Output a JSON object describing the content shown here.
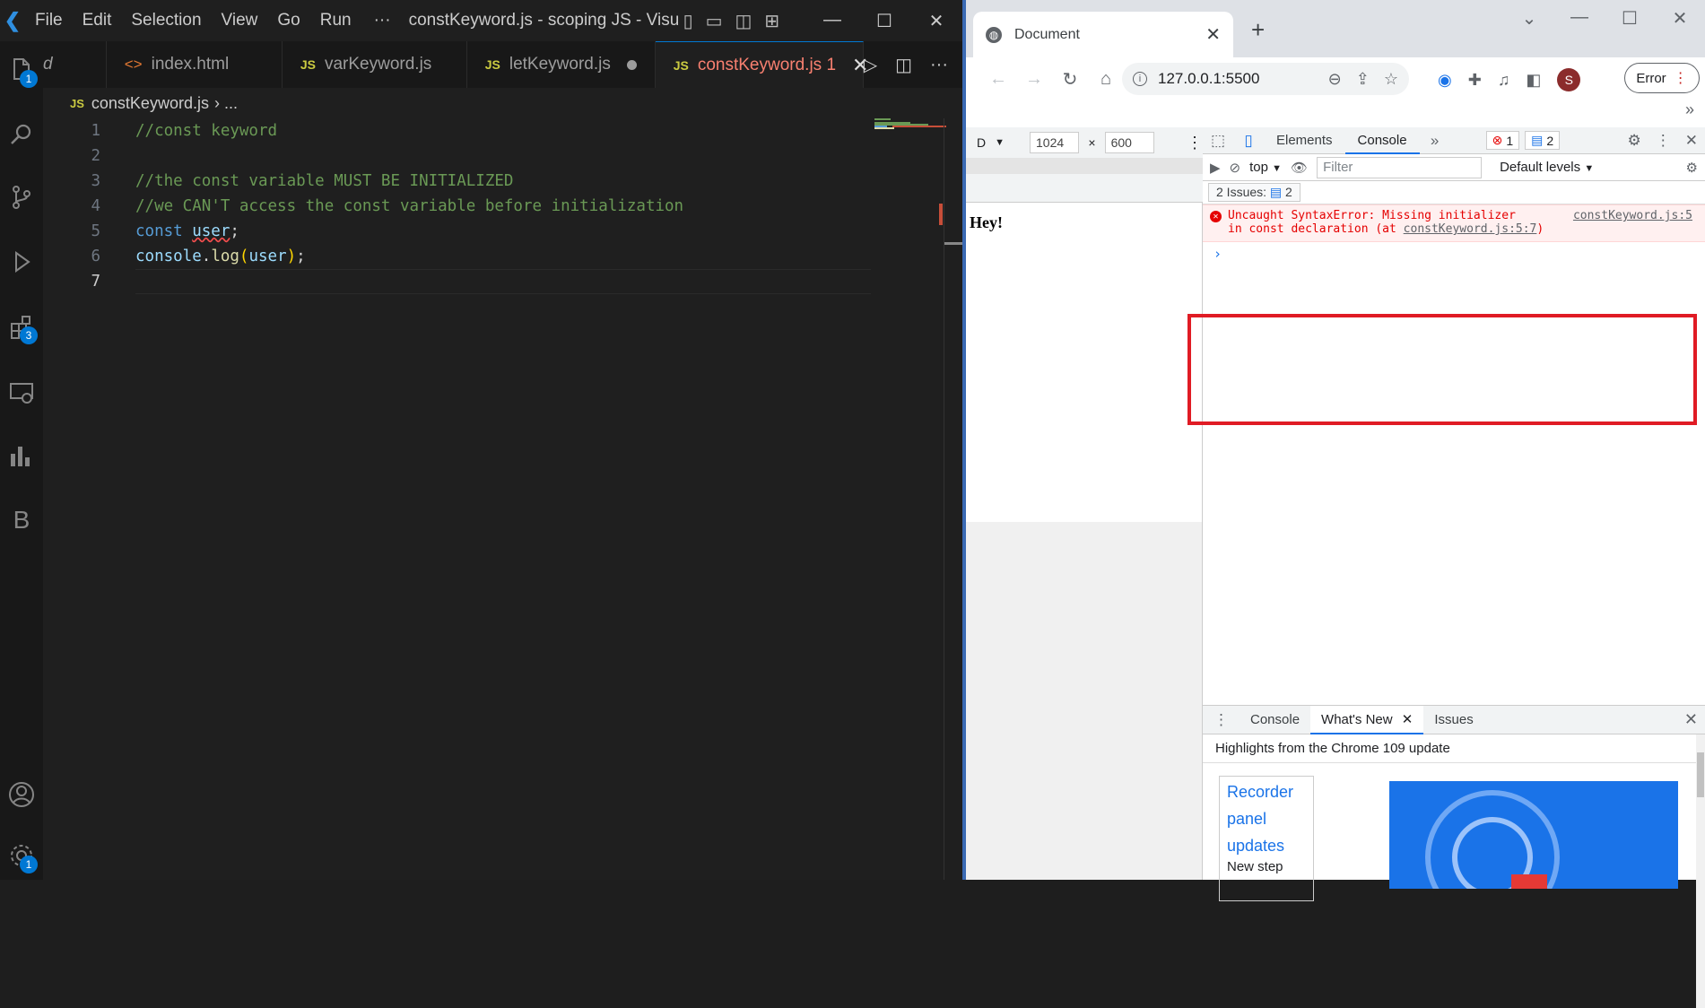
{
  "vscode": {
    "menu": [
      "File",
      "Edit",
      "Selection",
      "View",
      "Go",
      "Run"
    ],
    "more": "···",
    "window_title": "constKeyword.js - scoping JS - Visu...",
    "tabs": [
      {
        "label": "d",
        "icon": ""
      },
      {
        "label": "index.html",
        "icon": "<>"
      },
      {
        "label": "varKeyword.js",
        "icon": "JS"
      },
      {
        "label": "letKeyword.js",
        "icon": "JS"
      },
      {
        "label": "constKeyword.js 1",
        "icon": "JS"
      }
    ],
    "breadcrumb": {
      "icon": "JS",
      "file": "constKeyword.js",
      "rest": "› ..."
    },
    "activity_badges": {
      "explorer": "1",
      "extensions": "3",
      "accounts": "1"
    },
    "line_numbers": [
      "1",
      "2",
      "3",
      "4",
      "5",
      "6",
      "7"
    ],
    "code": {
      "l1": "//const keyword",
      "l3": "//the const variable MUST BE INITIALIZED",
      "l4": "//we CAN'T access the const variable before initialization",
      "l5_kw": "const",
      "l5_var": "user",
      "l5_end": ";",
      "l6_obj": "console",
      "l6_dot": ".",
      "l6_fn": "log",
      "l6_open": "(",
      "l6_arg": "user",
      "l6_close": ")",
      "l6_end": ";"
    }
  },
  "chrome": {
    "tab_title": "Document",
    "url": "127.0.0.1:5500",
    "profile_initial": "S",
    "error_button": "Error",
    "overflow": "»",
    "page_heading": "Hey!",
    "device": {
      "name": "D",
      "width": "1024",
      "x": "×",
      "height": "600"
    },
    "devtools": {
      "panels": [
        "Elements",
        "Console"
      ],
      "error_count": "1",
      "message_count": "2",
      "context": "top",
      "filter_placeholder": "Filter",
      "levels": "Default levels",
      "issues_label": "2 Issues:",
      "issues_count": "2",
      "error_message_1": "Uncaught SyntaxError: Missing initializer",
      "error_message_2": "in const declaration (at ",
      "error_link": "constKeyword.js:5:7",
      "error_close": ")",
      "error_source": "constKeyword.js:5",
      "prompt": "›",
      "drawer_tabs": [
        "Console",
        "What's New",
        "Issues"
      ],
      "highlights": "Highlights from the Chrome 109 update",
      "card_title_1": "Recorder",
      "card_title_2": "panel",
      "card_title_3": "updates",
      "card_sub": "New step"
    }
  },
  "colors": {
    "accent": "#0078d4",
    "error": "#e50000",
    "highlight_box": "#e01b24"
  }
}
